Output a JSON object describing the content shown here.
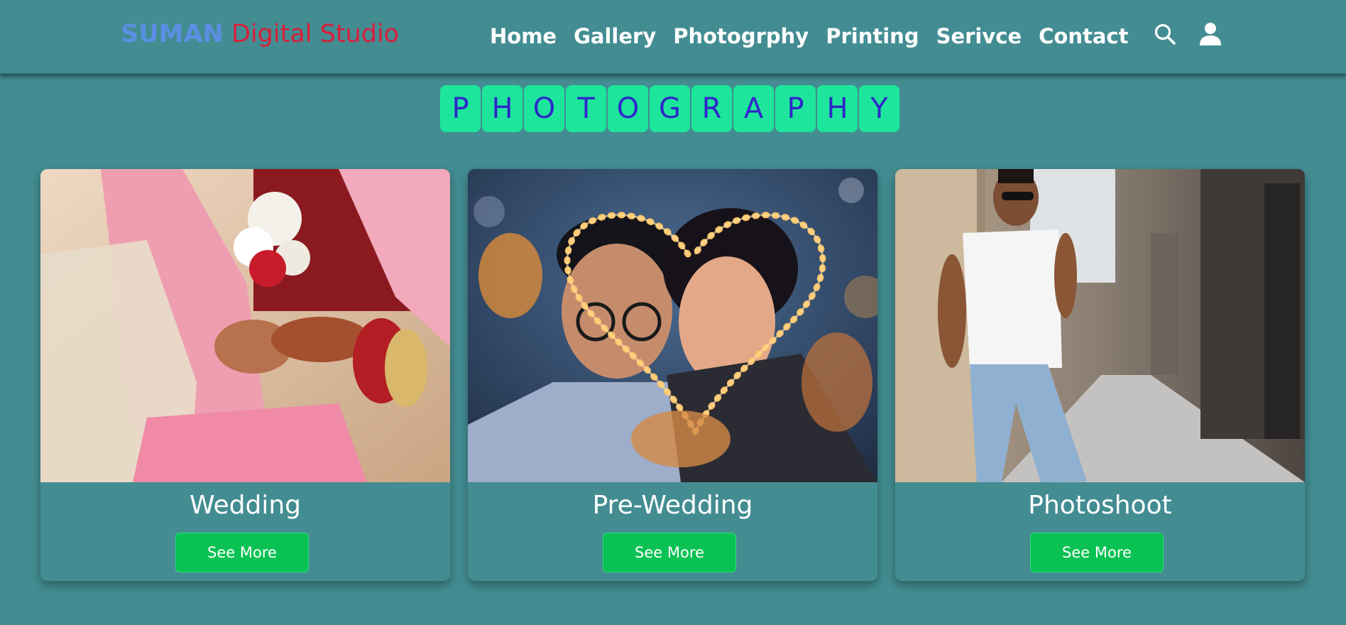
{
  "header": {
    "logo_brand": "SUMAN",
    "logo_rest": "Digital Studio",
    "nav": [
      "Home",
      "Gallery",
      "Photogrphy",
      "Printing",
      "Serivce",
      "Contact"
    ]
  },
  "section_title_letters": [
    "P",
    "H",
    "O",
    "T",
    "O",
    "G",
    "R",
    "A",
    "P",
    "H",
    "Y"
  ],
  "cards": [
    {
      "title": "Wedding",
      "button": "See More"
    },
    {
      "title": "Pre-Wedding",
      "button": "See More"
    },
    {
      "title": "Photoshoot",
      "button": "See More"
    }
  ],
  "colors": {
    "background": "#438d92",
    "logo_brand": "#5b8fe3",
    "logo_rest": "#d6203a",
    "tile_bg": "#1de69c",
    "tile_text": "#2f27c9",
    "button_bg": "#0ac153"
  },
  "icons": [
    "search-icon",
    "user-icon"
  ]
}
